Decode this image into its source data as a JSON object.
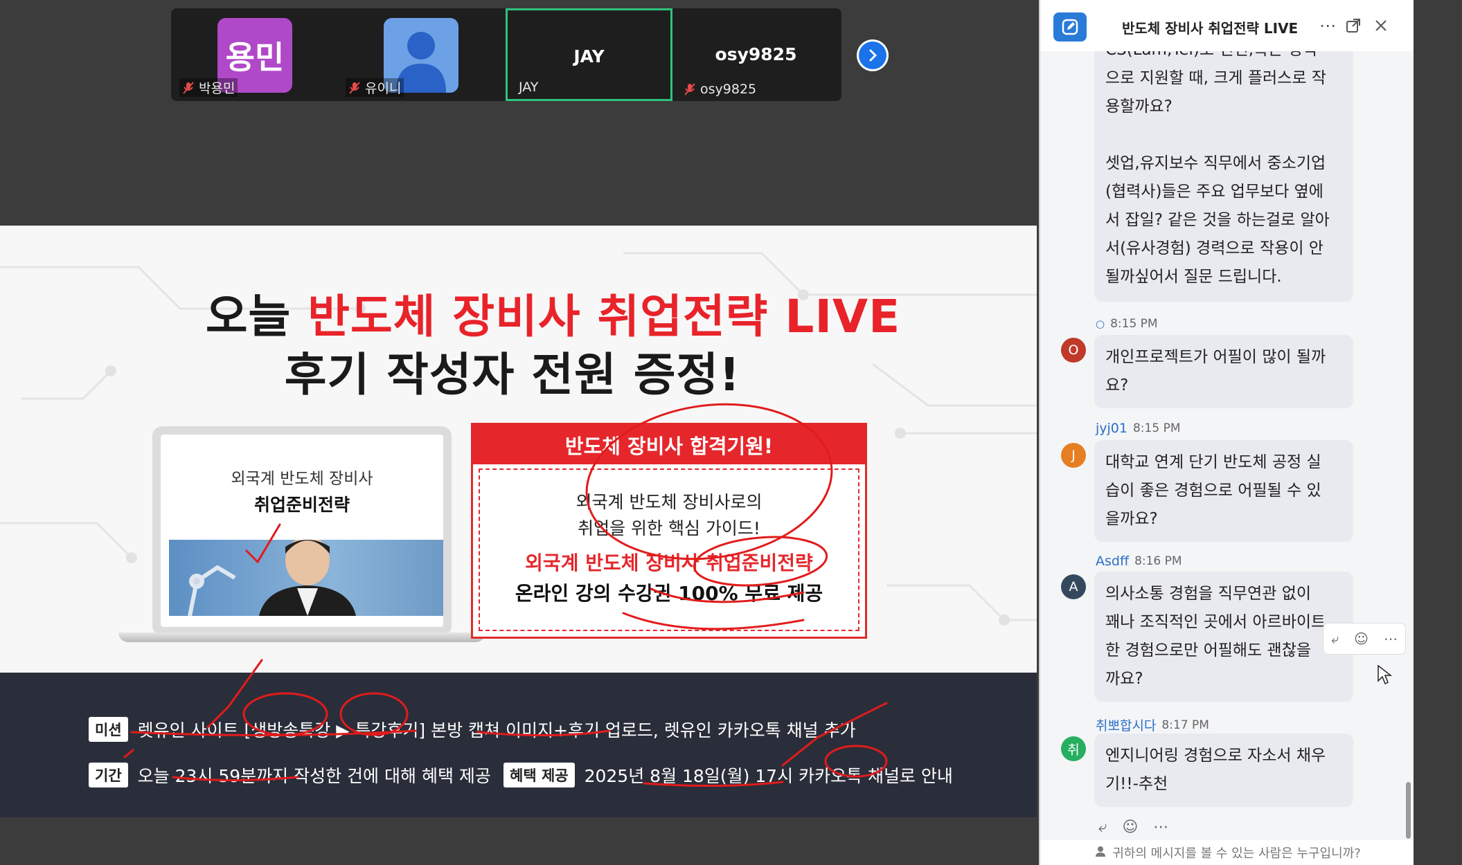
{
  "participants": [
    {
      "avatar_text": "용민",
      "name": "박용민",
      "color": "#b049c8",
      "muted": true
    },
    {
      "avatar_text": "",
      "name": "유이니",
      "color": "#6ca1e6",
      "muted": true
    },
    {
      "avatar_text": "JAY",
      "name": "JAY",
      "color": "#1e1e1e",
      "muted": false,
      "active": true
    },
    {
      "avatar_text": "osy9825",
      "name": "osy9825",
      "color": "#1e1e1e",
      "muted": true
    }
  ],
  "slide": {
    "headline1_prefix": "오늘 ",
    "headline1_red": "반도체 장비사 취업전략 LIVE",
    "headline2": "후기 작성자 전원 증정!",
    "laptop_line1": "외국계 반도체 장비사",
    "laptop_line2": "취업준비전략",
    "offer_band": "반도체 장비사 합격기원!",
    "offer_line1": "외국계 반도체 장비사로의",
    "offer_line2": "취업을 위한 핵심 가이드!",
    "offer_line3": "외국계 반도체 장비사 취업준비전략",
    "offer_line4": "온라인 강의 수강권 100% 무료 제공",
    "mission_tag": "미션",
    "mission_text": "렛유인 사이트 [생방송특강 ▶ 특강후기] 본방 캡쳐 이미지+후기 업로드, 렛유인 카카오톡 채널 추가",
    "period_tag": "기간",
    "period_text": "오늘 23시 59분까지 작성한 건에 대해 혜택 제공",
    "benefit_tag": "혜택 제공",
    "benefit_text": "2025년 8월 18일(월) 17시 카카오톡 채널로 안내"
  },
  "chat": {
    "title": "반도체 장비사 취업전략 LIVE",
    "messages": [
      {
        "author": "",
        "time": "",
        "avatar": "",
        "text": "CS(Lam,Tel)로 인턴,혹은 정직\n으로 지원할 때, 크게 플러스로 작\n용할까요?\n\n셋업,유지보수 직무에서 중소기업\n(협력사)들은 주요 업무보다 옆에\n서 잡일? 같은 것을 하는걸로 알아\n서(유사경험) 경력으로 작용이 안\n될까싶어서 질문 드립니다."
      },
      {
        "author": "",
        "time": "8:15 PM",
        "avatar": "O",
        "avatar_color": "#c0392b",
        "text": "개인프로젝트가 어필이 많이 될까\n요?"
      },
      {
        "author": "jyj01",
        "time": "8:15 PM",
        "avatar": "J",
        "avatar_color": "#e67e22",
        "text": "대학교 연계 단기 반도체 공정 실\n습이 좋은 경험으로 어필될 수 있\n을까요?"
      },
      {
        "author": "Asdff",
        "time": "8:16 PM",
        "avatar": "A",
        "avatar_color": "#34495e",
        "text": "의사소통 경험을 직무연관 없이\n꽤나 조직적인 곳에서 아르바이트\n한 경험으로만 어필해도 괜찮을\n까요?"
      },
      {
        "author": "취뽀합시다",
        "time": "8:17 PM",
        "avatar": "취",
        "avatar_color": "#27ae60",
        "text": "엔지니어링 경험으로 자소서 채우\n기!!-추천"
      }
    ],
    "footer_text": "귀하의 메시지를 볼 수 있는 사람은 누구입니까?"
  }
}
